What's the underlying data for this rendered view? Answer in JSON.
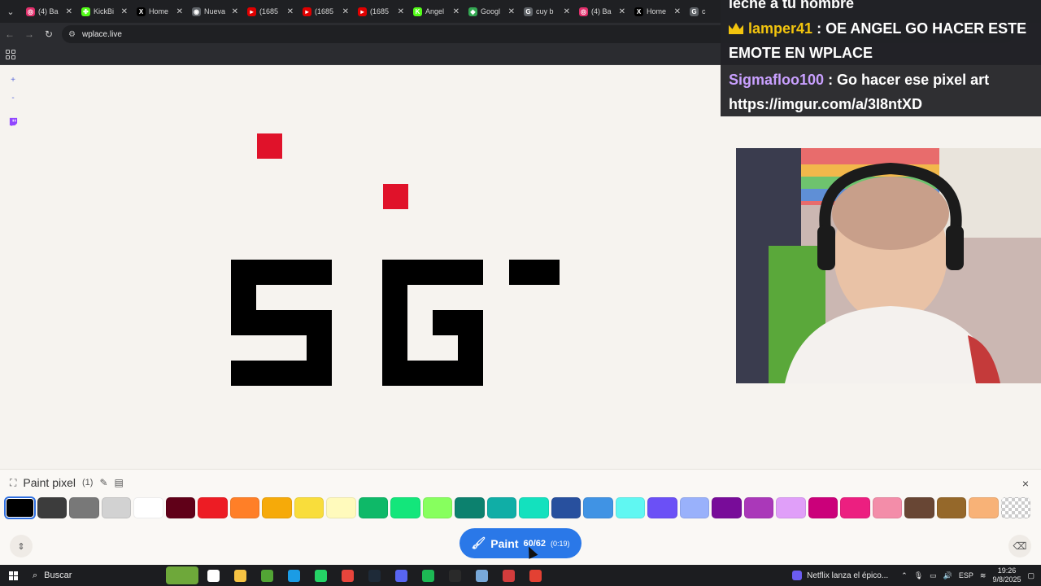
{
  "browser": {
    "tabs": [
      {
        "label": "(4) Ba",
        "color": "#e1306c",
        "glyph": "◎"
      },
      {
        "label": "KickBi",
        "color": "#53fc18",
        "glyph": "✤"
      },
      {
        "label": "Home",
        "color": "#000000",
        "glyph": "X"
      },
      {
        "label": "Nueva",
        "color": "#5f6368",
        "glyph": "◉"
      },
      {
        "label": "(1685",
        "color": "#e00000",
        "glyph": "▸"
      },
      {
        "label": "(1685",
        "color": "#e00000",
        "glyph": "▸"
      },
      {
        "label": "(1685",
        "color": "#e00000",
        "glyph": "▸"
      },
      {
        "label": "Angel",
        "color": "#53fc18",
        "glyph": "K"
      },
      {
        "label": "Googl",
        "color": "#34a853",
        "glyph": "◆"
      },
      {
        "label": "cuy b",
        "color": "#5f6368",
        "glyph": "G"
      },
      {
        "label": "(4) Ba",
        "color": "#e1306c",
        "glyph": "◎"
      },
      {
        "label": "Home",
        "color": "#000000",
        "glyph": "X"
      },
      {
        "label": "c",
        "color": "#5f6368",
        "glyph": "G"
      }
    ],
    "url": "wplace.live"
  },
  "canvas": {
    "zoom_in_label": "+",
    "zoom_out_label": "-",
    "pixels": [
      {
        "col": 10,
        "row": 2,
        "w": 1,
        "h": 1,
        "color": "#e0122a"
      },
      {
        "col": 15,
        "row": 4,
        "w": 1,
        "h": 1,
        "color": "#e0122a"
      },
      {
        "col": 20,
        "row": 7,
        "w": 2,
        "h": 1,
        "color": "#000000"
      }
    ]
  },
  "chat": {
    "lines": [
      {
        "user": "",
        "message": "leche a tu nombre",
        "user_color": "#ffffff"
      },
      {
        "user": "lamper41",
        "message": ": OE ANGEL GO HACER ESTE",
        "user_color": "#f2c40e",
        "badge": "crown-icon"
      },
      {
        "user": "",
        "message": "EMOTE EN WPLACE",
        "user_color": "#ffffff"
      },
      {
        "user": "Sigmafloo100",
        "message": ": Go hacer ese pixel art",
        "user_color": "#c9a0ff"
      },
      {
        "user": "",
        "message": "https://imgur.com/a/3I8ntXD",
        "user_color": "#ffffff"
      }
    ]
  },
  "panel": {
    "title": "Paint pixel",
    "count": "(1)",
    "close_label": "×",
    "palette": [
      "#000000",
      "#3c3c3c",
      "#787878",
      "#d2d2d2",
      "#ffffff",
      "#600018",
      "#ed1c24",
      "#ff7f27",
      "#f6aa09",
      "#f9dd3b",
      "#fffabc",
      "#0eb968",
      "#13e67b",
      "#87ff5e",
      "#0c816e",
      "#10aea6",
      "#13e1be",
      "#28509e",
      "#4093e4",
      "#60f7f2",
      "#6b50f6",
      "#99b1fb",
      "#780c99",
      "#aa38b9",
      "#e09ff9",
      "#cb007a",
      "#ec1f80",
      "#f38da9",
      "#684634",
      "#95682a",
      "#f8b277",
      "transparent"
    ],
    "selected_index": 0,
    "paint_button": {
      "label": "Paint",
      "count": "60/62",
      "timer": "(0:19)"
    }
  },
  "taskbar": {
    "search_label": "Buscar",
    "news_label": "Netflix lanza el épico...",
    "language": "ESP",
    "time": "19:26",
    "date": "9/8/2025",
    "apps": [
      "#6ea83a",
      "#ffffff",
      "#f6c343",
      "#52a535",
      "#1b9ce5",
      "#25d366",
      "#e8453c",
      "#1e2a38",
      "#5865f2",
      "#1db954",
      "#2a2a2a",
      "#78a8d8",
      "#d23c3c",
      "#e34133"
    ]
  }
}
